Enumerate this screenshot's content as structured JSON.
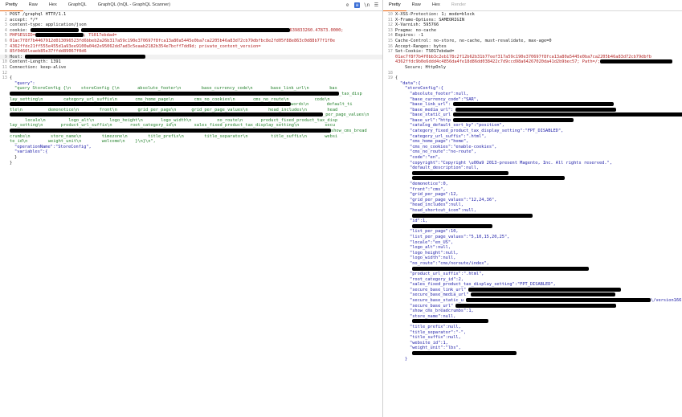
{
  "left_tabs": [
    "Pretty",
    "Raw",
    "Hex",
    "GraphQL",
    "GraphQL (InQL - GraphQL Scanner)"
  ],
  "right_tabs": [
    "Pretty",
    "Raw",
    "Hex",
    "Render"
  ],
  "request": {
    "l1": "POST /graphql HTTP/1.1",
    "l2": "accept: */*",
    "l3": "content-type: application/json",
    "l4a": "cookie: ",
    "l4b": "639833260.47873.0000;",
    "l5a": "PHPSESSID=",
    "l5b": "; TS017ebdad=",
    "l6": "01ac7f8f7b4467912d013096523fd6bbeb2a26b317a59c190e370697f8fca13a80a5445e0ba7ca2205b46a83d72cb79dbfbc8e2fd05f88e863c0d88b77f1f0e",
    "l7": "4362ffdc21ff555e455d1a93ee9100a04d2e95062dd7ad3c5eaab2182b354e7bcff7dd9d; private_content_version=",
    "l8": "85f0460leaeb85e37ffdd89067f0d6",
    "l9": "Host: ",
    "l10": "Content-Length: 1391",
    "l11": "Connection: keep-alive",
    "l13": "{",
    "l14": "\"query\":",
    "q1": "\"query StoreConfig {\\n    storeConfig {\\n       absolute_footer\\n        base_currency_code\\n       base_link_url\\n        bas",
    "q2": "_tax_disp",
    "q3": "lay_setting\\n        category_url_suffix\\n       cms_home_page\\n        cms_no_cookies\\n       cms_no_route\\n          code\\n",
    "q4": "words\\n       default_ti",
    "q5": "tle\\n          demonotice\\n        front\\n        grid_per_page\\n      grid_per_page_values\\n        head_includes\\n        head",
    "q6": "_per_page_values\\n",
    "q7": "      locale\\n         logo_alt\\n      logo_height\\n       logo_width\\n          no_route\\n       product_fixed_product_tax_disp",
    "q8": "lay_setting\\n       product_url_suffix\\n       root_category_id\\n       sales_fixed_product_tax_display_setting\\n          secu",
    "q9": "show_cms_bread",
    "q10": "crumbs\\n        store_name\\n        timezone\\n        title_prefix\\n        title_separator\\n         title_suffix\\n       websi",
    "q11": "te_id\\n        weight_unit\\n        welcome\\n    }\\n}\\n\",",
    "op": "\"operationName\":\"StoreConfig\",",
    "vars": "\"variables\":{",
    "close1": "}",
    "close2": "}"
  },
  "response": {
    "h10": "X-XSS-Protection: 1; mode=block",
    "h11": "X-Frame-Options: SAMEORIGIN",
    "h12": "X-Varnish: 595766",
    "h13": "Pragma: no-cache",
    "h14": "Expires: -1",
    "h15": "Cache-Control: no-store, no-cache, must-revalidate, max-age=0",
    "h16": "Accept-Ranges: bytes",
    "h17": "Set-Cookie: TS017ebdad=",
    "h17b": "01ac7f8f7b4f0bb3c2eb178c2f12b62b31b77eef317a59c190e370697f8fca13a80a5445e0ba7ca2205b46a83d72cb79dbfb",
    "h17c": "4362ffdc9b0e6ddd4c4856da4fe18d86dd038422c7d9ccd98a64267020da41d2b9bec57; Path=/;",
    "h17d": "Secure; HttpOnly",
    "b19": "{",
    "b20": "\"data\":{",
    "b21": "\"storeConfig\":{",
    "lines": [
      "\"absolute_footer\":null,",
      "\"base_currency_code\":\"SAR\",",
      "\"base_link_url\":",
      "\"base_media_url\":",
      "\"base_static_url",
      "\"base_url\":\"http",
      "\"catalog_default_sort_by\":\"position\",",
      "\"category_fixed_product_tax_display_setting\":\"FPT_DISABLED\",",
      "\"category_url_suffix\":\".html\",",
      "\"cms_home_page\":\"home\",",
      "\"cms_no_cookies\":\"enable-cookies\",",
      "\"cms_no_route\":\"no-route\",",
      "\"code\":\"en\",",
      "\"copyright\":\"Copyright \\u00a9 2013-present Magento, Inc. All rights reserved.\",",
      "\"default_description\":null,",
      "",
      "",
      "\"demonotice\":0,",
      "\"front\":\"cms\",",
      "\"grid_per_page\":12,",
      "\"grid_per_page_values\":\"12,24,36\",",
      "\"head_includes\":null,",
      "\"head_shortcut_icon\":null,",
      "",
      "\"id\":1,",
      "",
      "\"list_per_page\":10,",
      "\"list_per_page_values\":\"5,10,15,20,25\",",
      "\"locale\":\"en_US\",",
      "\"logo_alt\":null,",
      "\"logo_height\":null,",
      "\"logo_width\":null,",
      "\"no_route\":\"cms/noroute/index\",",
      "",
      "\"product_url_suffix\":\".html\",",
      "\"root_category_id\":2,",
      "\"sales_fixed_product_tax_display_setting\":\"FPT_DISABLED\",",
      "\"secure_base_link_url\"",
      "\"secure_base_media_url\"",
      "\"secure_base_static_u",
      "\"secure_base_url\"",
      "\"show_cms_breadcrumbs\":1,",
      "\"store_name\":null,",
      "",
      "\"title_prefix\":null,",
      "\"title_separator\":\"-\",",
      "\"title_suffix\":null,",
      "\"website_id\":1,",
      "\"weight_unit\":\"lbs\",",
      "",
      "}"
    ],
    "static_tail": "sa/static\\/version1663048364",
    "media_tail": "\\/version166"
  }
}
